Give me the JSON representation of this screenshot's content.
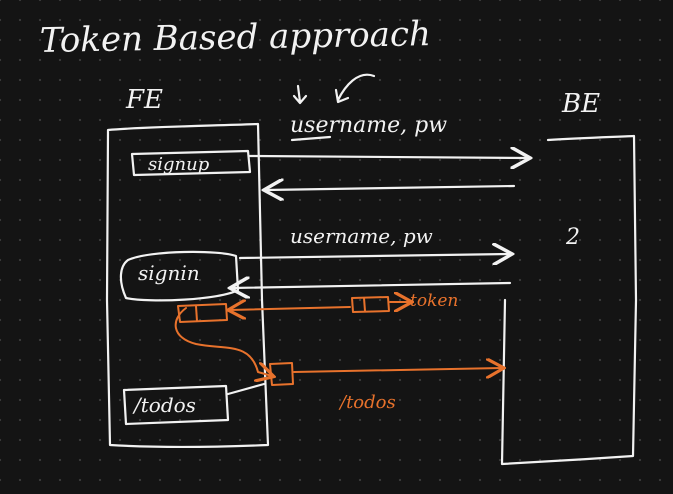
{
  "title": "Token Based approach",
  "frontend_label": "FE",
  "backend_label": "BE",
  "signup_label": "signup",
  "signin_label": "signin",
  "todos_label": "/todos",
  "credentials_top": "username, pw",
  "credentials_mid": "username, pw",
  "token_label": "token",
  "todos_request_label": "/todos",
  "colors": {
    "ink": "#f2f2f2",
    "highlight": "#e8722c",
    "background": "#141414"
  }
}
